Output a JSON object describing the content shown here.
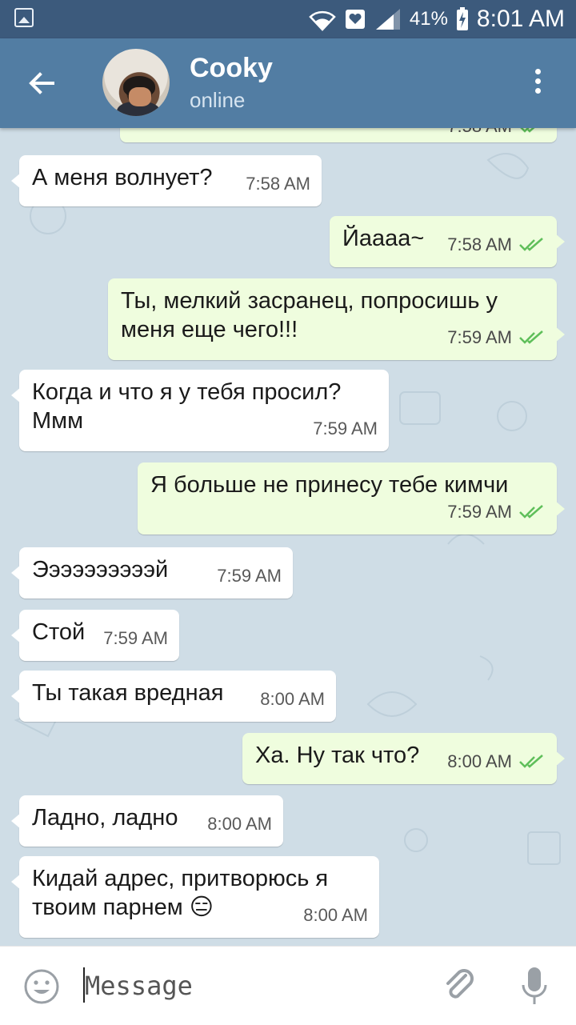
{
  "status_bar": {
    "battery": "41%",
    "time": "8:01 AM"
  },
  "header": {
    "contact_name": "Cooky",
    "contact_status": "online"
  },
  "colors": {
    "toolbar": "#527da3",
    "status_bar": "#3c5a7c",
    "incoming_bubble": "#ffffff",
    "outgoing_bubble": "#effdde",
    "read_check": "#5fbf5a"
  },
  "messages": [
    {
      "direction": "out",
      "text": "",
      "time": "7:58 AM",
      "status": "read",
      "partial": true
    },
    {
      "direction": "in",
      "text": "А меня волнует?",
      "time": "7:58 AM"
    },
    {
      "direction": "out",
      "text": "Йаааа~",
      "time": "7:58 AM",
      "status": "read"
    },
    {
      "direction": "out",
      "text": "Ты, мелкий засранец, попросишь у меня еще чего!!!",
      "time": "7:59 AM",
      "status": "read"
    },
    {
      "direction": "in",
      "text": "Когда и что я у тебя просил? Ммм",
      "time": "7:59 AM"
    },
    {
      "direction": "out",
      "text": "Я больше не принесу тебе кимчи",
      "time": "7:59 AM",
      "status": "read"
    },
    {
      "direction": "in",
      "text": "Ээээээээээй",
      "time": "7:59 AM"
    },
    {
      "direction": "in",
      "text": "Стой",
      "time": "7:59 AM"
    },
    {
      "direction": "in",
      "text": "Ты такая вредная",
      "time": "8:00 AM"
    },
    {
      "direction": "out",
      "text": "Ха. Ну так что?",
      "time": "8:00 AM",
      "status": "read"
    },
    {
      "direction": "in",
      "text": "Ладно, ладно",
      "time": "8:00 AM"
    },
    {
      "direction": "in",
      "text": "Кидай адрес, притворюсь я твоим парнем 😑",
      "time": "8:00 AM"
    }
  ],
  "composer": {
    "placeholder": "Message"
  }
}
